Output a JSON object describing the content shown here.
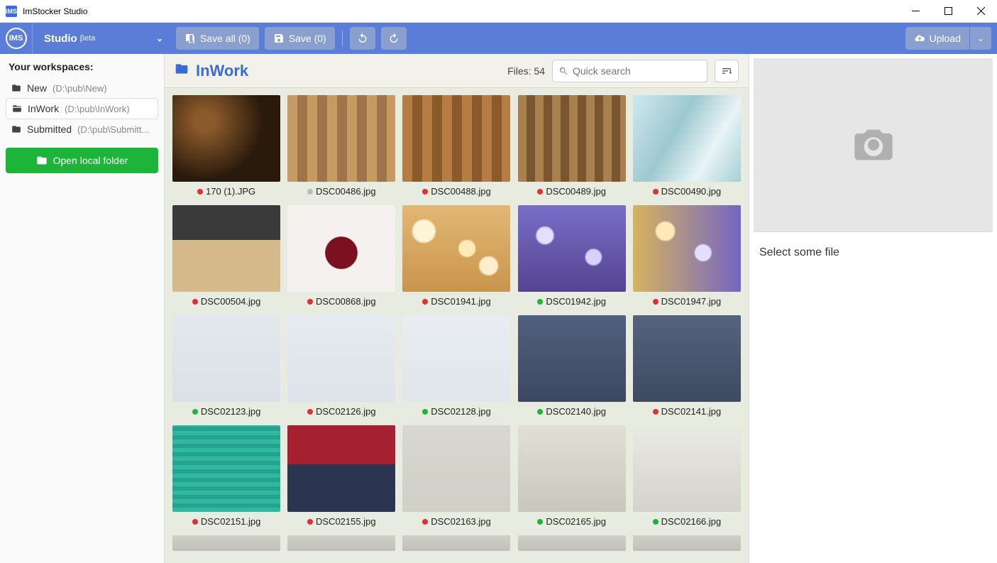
{
  "window": {
    "title": "ImStocker Studio",
    "app_icon_text": "IMS"
  },
  "brand": {
    "circle_text": "IMS",
    "studio_label": "Studio",
    "beta_label": "βeta"
  },
  "toolbar": {
    "save_all_label": "Save all (0)",
    "save_label": "Save (0)",
    "upload_label": "Upload"
  },
  "sidebar": {
    "title": "Your workspaces:",
    "items": [
      {
        "name": "New",
        "path": "(D:\\pub\\New)",
        "active": false
      },
      {
        "name": "InWork",
        "path": "(D:\\pub\\InWork)",
        "active": true
      },
      {
        "name": "Submitted",
        "path": "(D:\\pub\\Submitt...",
        "active": false
      }
    ],
    "open_label": "Open local folder"
  },
  "center": {
    "folder_name": "InWork",
    "files_label": "Files: 54",
    "search_placeholder": "Quick search"
  },
  "right": {
    "message": "Select some file"
  },
  "files": [
    {
      "name": "170 (1).JPG",
      "status": "red",
      "bg": "bg-grill"
    },
    {
      "name": "DSC00486.jpg",
      "status": "gray",
      "bg": "bg-wood1"
    },
    {
      "name": "DSC00488.jpg",
      "status": "red",
      "bg": "bg-wood2"
    },
    {
      "name": "DSC00489.jpg",
      "status": "red",
      "bg": "bg-wood3"
    },
    {
      "name": "DSC00490.jpg",
      "status": "red",
      "bg": "bg-paint"
    },
    {
      "name": "DSC00504.jpg",
      "status": "red",
      "bg": "bg-desk"
    },
    {
      "name": "DSC00868.jpg",
      "status": "red",
      "bg": "bg-wine"
    },
    {
      "name": "DSC01941.jpg",
      "status": "red",
      "bg": "bg-bokeh-gold"
    },
    {
      "name": "DSC01942.jpg",
      "status": "green",
      "bg": "bg-bokeh-purple"
    },
    {
      "name": "DSC01947.jpg",
      "status": "red",
      "bg": "bg-bokeh-mix"
    },
    {
      "name": "DSC02123.jpg",
      "status": "green",
      "bg": "bg-strip1"
    },
    {
      "name": "DSC02126.jpg",
      "status": "red",
      "bg": "bg-strip2"
    },
    {
      "name": "DSC02128.jpg",
      "status": "green",
      "bg": "bg-strip3"
    },
    {
      "name": "DSC02140.jpg",
      "status": "green",
      "bg": "bg-leather1"
    },
    {
      "name": "DSC02141.jpg",
      "status": "red",
      "bg": "bg-leather2"
    },
    {
      "name": "DSC02151.jpg",
      "status": "red",
      "bg": "bg-knit-green"
    },
    {
      "name": "DSC02155.jpg",
      "status": "red",
      "bg": "bg-knit-red"
    },
    {
      "name": "DSC02163.jpg",
      "status": "red",
      "bg": "bg-pills1"
    },
    {
      "name": "DSC02165.jpg",
      "status": "green",
      "bg": "bg-pills2"
    },
    {
      "name": "DSC02166.jpg",
      "status": "green",
      "bg": "bg-pills3"
    }
  ]
}
